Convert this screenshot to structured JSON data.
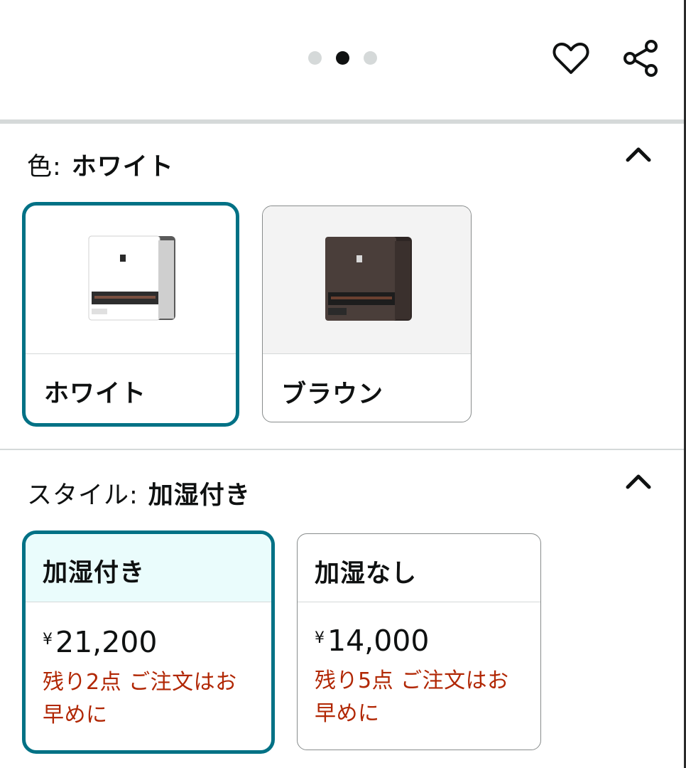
{
  "carousel": {
    "count": 3,
    "active_index": 1
  },
  "icons": {
    "favorite": "heart-outline-icon",
    "share": "share-icon",
    "collapse": "chevron-up-icon"
  },
  "colors": {
    "accent": "#007185",
    "selected_header_bg": "#eafcfc",
    "stock_text": "#b12704",
    "divider": "#d5d9d9"
  },
  "color_section": {
    "label": "色:",
    "selected_value": "ホワイト",
    "options": [
      {
        "name": "ホワイト",
        "image": "white-heater-image",
        "selected": true
      },
      {
        "name": "ブラウン",
        "image": "brown-heater-image",
        "selected": false
      }
    ]
  },
  "style_section": {
    "label": "スタイル:",
    "selected_value": "加湿付き",
    "options": [
      {
        "name": "加湿付き",
        "currency": "¥",
        "price": "21,200",
        "stock_line1": "残り2点 ご注文はお",
        "stock_line2": "早めに",
        "selected": true
      },
      {
        "name": "加湿なし",
        "currency": "¥",
        "price": "14,000",
        "stock_line1": "残り5点 ご注文はお",
        "stock_line2": "早めに",
        "selected": false
      }
    ]
  }
}
